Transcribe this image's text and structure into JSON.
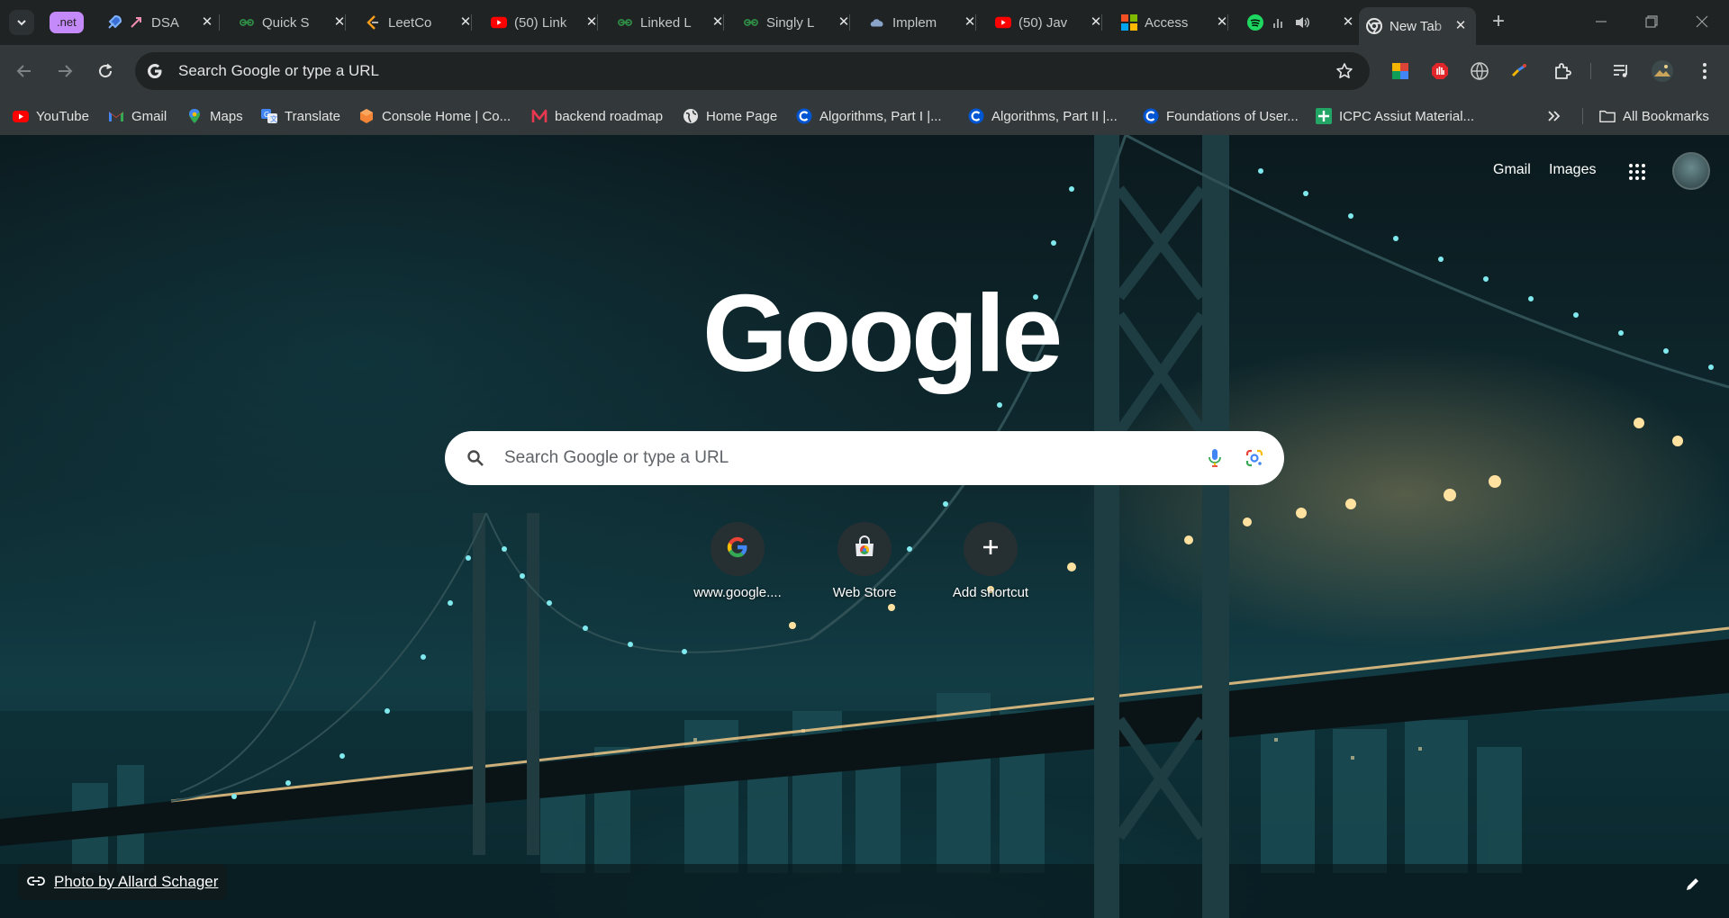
{
  "browser": {
    "tab_group_label": ".net",
    "tabs": [
      {
        "title": "DSA",
        "icon": "rocket-icon"
      },
      {
        "title": "Quick S",
        "icon": "geeksforgeeks-icon"
      },
      {
        "title": "LeetCo",
        "icon": "leetcode-icon"
      },
      {
        "title": "(50) Link",
        "icon": "youtube-icon"
      },
      {
        "title": "Linked L",
        "icon": "geeksforgeeks-icon"
      },
      {
        "title": "Singly L",
        "icon": "geeksforgeeks-icon"
      },
      {
        "title": "Implem",
        "icon": "cloud-icon"
      },
      {
        "title": "(50) Jav",
        "icon": "youtube-icon"
      },
      {
        "title": "Access",
        "icon": "microsoft-icon"
      },
      {
        "title": "",
        "icon": "spotify-icon"
      },
      {
        "title": "New Tab",
        "icon": "chrome-icon",
        "active": true
      }
    ]
  },
  "toolbar": {
    "omnibox_placeholder": "Search Google or type a URL"
  },
  "bookmarks": [
    {
      "label": "YouTube",
      "icon": "youtube-icon"
    },
    {
      "label": "Gmail",
      "icon": "gmail-icon"
    },
    {
      "label": "Maps",
      "icon": "maps-icon"
    },
    {
      "label": "Translate",
      "icon": "translate-icon"
    },
    {
      "label": "Console Home | Co...",
      "icon": "aws-icon"
    },
    {
      "label": "backend roadmap",
      "icon": "medium-icon"
    },
    {
      "label": "Home Page",
      "icon": "globe-icon"
    },
    {
      "label": "Algorithms, Part I |...",
      "icon": "coursera-icon"
    },
    {
      "label": "Algorithms, Part II |...",
      "icon": "coursera-icon"
    },
    {
      "label": "Foundations of User...",
      "icon": "coursera-icon"
    },
    {
      "label": "ICPC Assiut Material...",
      "icon": "sheets-icon"
    }
  ],
  "bookmarks_all_label": "All Bookmarks",
  "ntp": {
    "top_links": {
      "gmail": "Gmail",
      "images": "Images"
    },
    "logo": "Google",
    "search_placeholder": "Search Google or type a URL",
    "shortcuts": [
      {
        "label": "www.google....",
        "icon": "google-icon"
      },
      {
        "label": "Web Store",
        "icon": "web-store-icon"
      },
      {
        "label": "Add shortcut",
        "icon": "plus-icon"
      }
    ],
    "attribution": "Photo by Allard Schager"
  },
  "colors": {
    "toolbar_bg": "#33393a",
    "tabstrip_bg": "#1f2324",
    "group_chip": "#c58af9"
  }
}
